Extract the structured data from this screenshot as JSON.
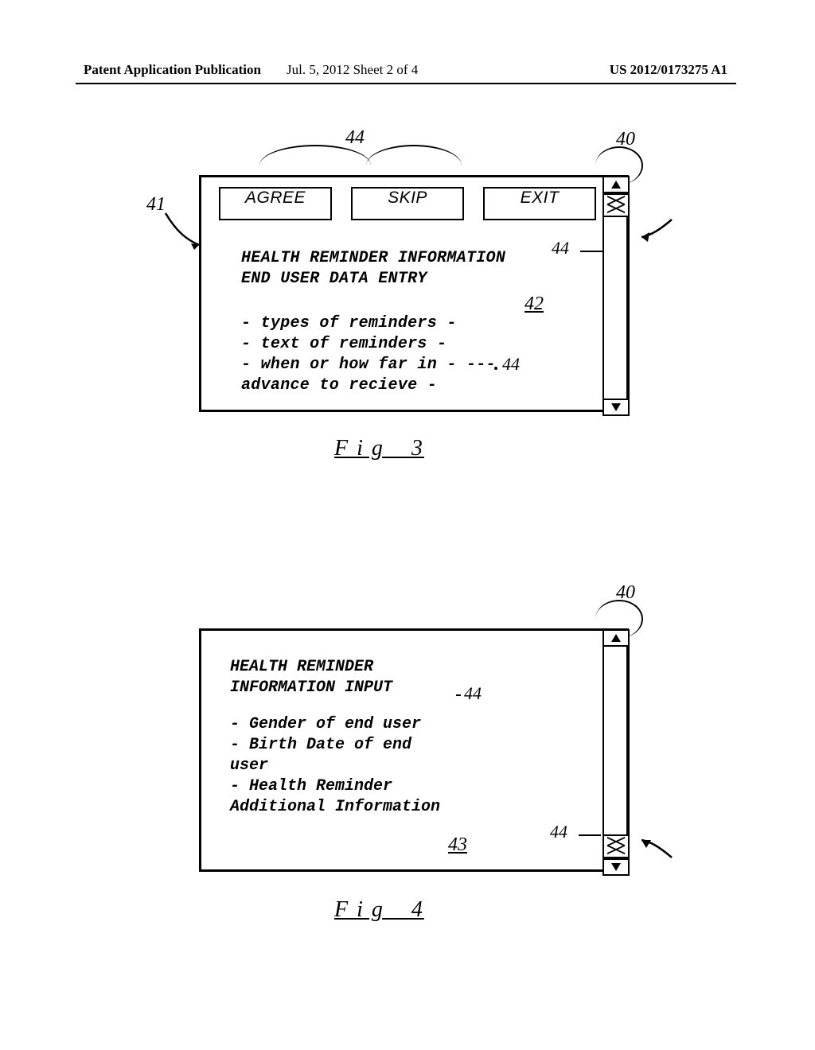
{
  "header": {
    "left": "Patent Application Publication",
    "mid": "Jul. 5, 2012   Sheet 2 of 4",
    "right": "US 2012/0173275 A1"
  },
  "fig3": {
    "ref_44a": "44",
    "ref_40": "40",
    "ref_41": "41",
    "ref_44b": "44",
    "ref_42": "42",
    "ref_44c": "44",
    "buttons": {
      "agree": "AGREE",
      "skip": "SKIP",
      "exit": "EXIT"
    },
    "title1": "HEALTH REMINDER INFORMATION",
    "title2": "END USER DATA ENTRY",
    "line1": "- types of reminders -",
    "line2": "- text of reminders  -",
    "line3": "- when or how far in - ---",
    "line4": "advance to recieve   -",
    "caption": "F i g _ 3"
  },
  "fig4": {
    "ref_40": "40",
    "ref_44a": "44",
    "ref_44b": "44",
    "ref_43": "43",
    "title1": "HEALTH REMINDER",
    "title2": "INFORMATION INPUT",
    "line1": "-   Gender of end user",
    "line2": "-   Birth Date of end",
    "line3": "user",
    "line4": "-   Health Reminder",
    "line5": "Additional Information",
    "caption": "F i g _ 4"
  }
}
